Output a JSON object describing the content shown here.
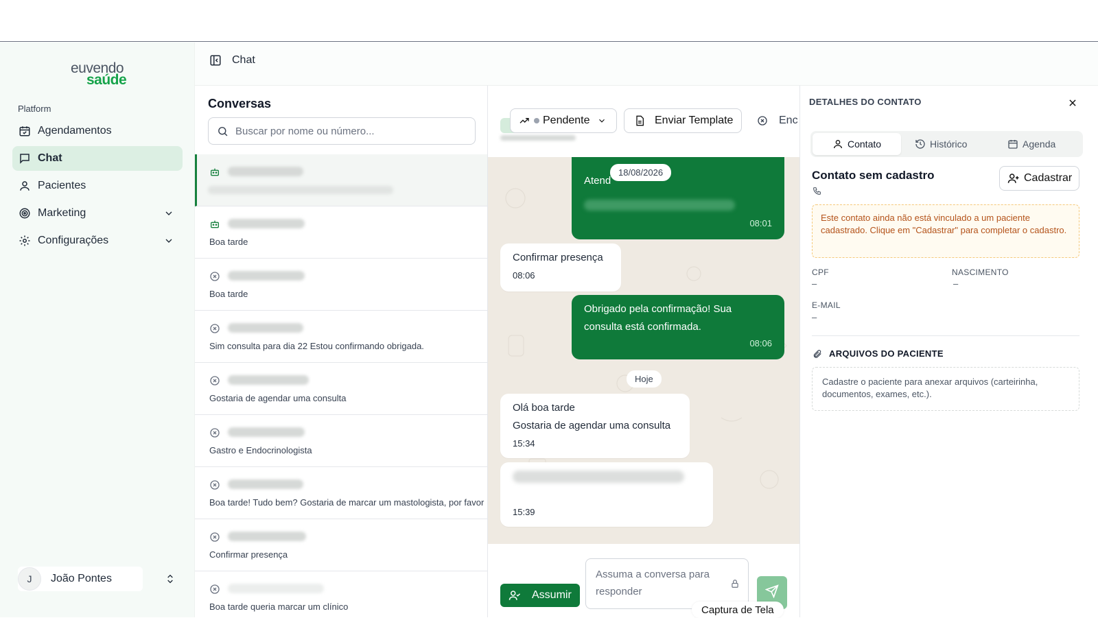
{
  "app": {
    "logo_line1": "euvendo",
    "logo_line2": "saúde",
    "header_title": "Chat"
  },
  "sidebar": {
    "section_label": "Platform",
    "items": [
      {
        "label": "Agendamentos",
        "icon": "calendar-icon",
        "active": false
      },
      {
        "label": "Chat",
        "icon": "message-square-icon",
        "active": true
      },
      {
        "label": "Pacientes",
        "icon": "user-icon",
        "active": false
      },
      {
        "label": "Marketing",
        "icon": "target-icon",
        "active": false,
        "expandable": true
      },
      {
        "label": "Configurações",
        "icon": "gear-icon",
        "active": false,
        "expandable": true
      }
    ],
    "user": {
      "initial": "J",
      "name": "João Pontes"
    }
  },
  "conversations": {
    "title": "Conversas",
    "search_placeholder": "Buscar por nome ou número...",
    "items": [
      {
        "icon": "bot-icon",
        "preview": "",
        "selected": true
      },
      {
        "icon": "bot-icon",
        "preview": "Boa tarde"
      },
      {
        "icon": "circle-x-icon",
        "preview": "Boa tarde"
      },
      {
        "icon": "circle-x-icon",
        "preview": "Sim consulta para dia 22 Estou confirmando obrigada."
      },
      {
        "icon": "circle-x-icon",
        "preview": "Gostaria de agendar uma consulta"
      },
      {
        "icon": "circle-x-icon",
        "preview": "Gastro e Endocrinologista"
      },
      {
        "icon": "circle-x-icon",
        "preview": "Boa tarde! Tudo bem? Gostaria de marcar um mastologista, por favor"
      },
      {
        "icon": "circle-x-icon",
        "preview": "Confirmar presença"
      },
      {
        "icon": "circle-x-icon",
        "preview": "Boa tarde queria marcar um clínico"
      }
    ]
  },
  "chat": {
    "status_label": "Pendente",
    "template_button": "Enviar Template",
    "end_button_partial": "Enc",
    "messages": {
      "m1_text": "Atend",
      "m1_time": "08:01",
      "date_1": "18/08/2026",
      "m2_text": "Confirmar presença",
      "m2_time": "08:06",
      "m3_text": "Obrigado pela confirmação! Sua consulta está confirmada.",
      "m3_time": "08:06",
      "date_2": "Hoje",
      "m4_line1": "Olá boa tarde",
      "m4_line2": "Gostaria de agendar uma consulta",
      "m4_time": "15:34",
      "m5_time": "15:39"
    },
    "assume_button": "Assumir",
    "reply_placeholder": "Assuma a conversa para responder",
    "screenshot_tooltip": "Captura de Tela"
  },
  "details": {
    "title": "DETALHES DO CONTATO",
    "tabs": [
      "Contato",
      "Histórico",
      "Agenda"
    ],
    "contact_name": "Contato sem cadastro",
    "register_button": "Cadastrar",
    "warning": "Este contato ainda não está vinculado a um paciente cadastrado. Clique em \"Cadastrar\" para completar o cadastro.",
    "cpf_label": "CPF",
    "cpf_value": "–",
    "birth_label": "NASCIMENTO",
    "birth_value": "–",
    "email_label": "E-MAIL",
    "email_value": "–",
    "files_title": "ARQUIVOS DO PACIENTE",
    "files_hint": "Cadastre o paciente para anexar arquivos (carteirinha, documentos, exames, etc.)."
  },
  "colors": {
    "brand_green": "#0f7a3a",
    "logo_green": "#16a34a",
    "chat_bg": "#efeae2",
    "warning_text": "#b4531a"
  }
}
